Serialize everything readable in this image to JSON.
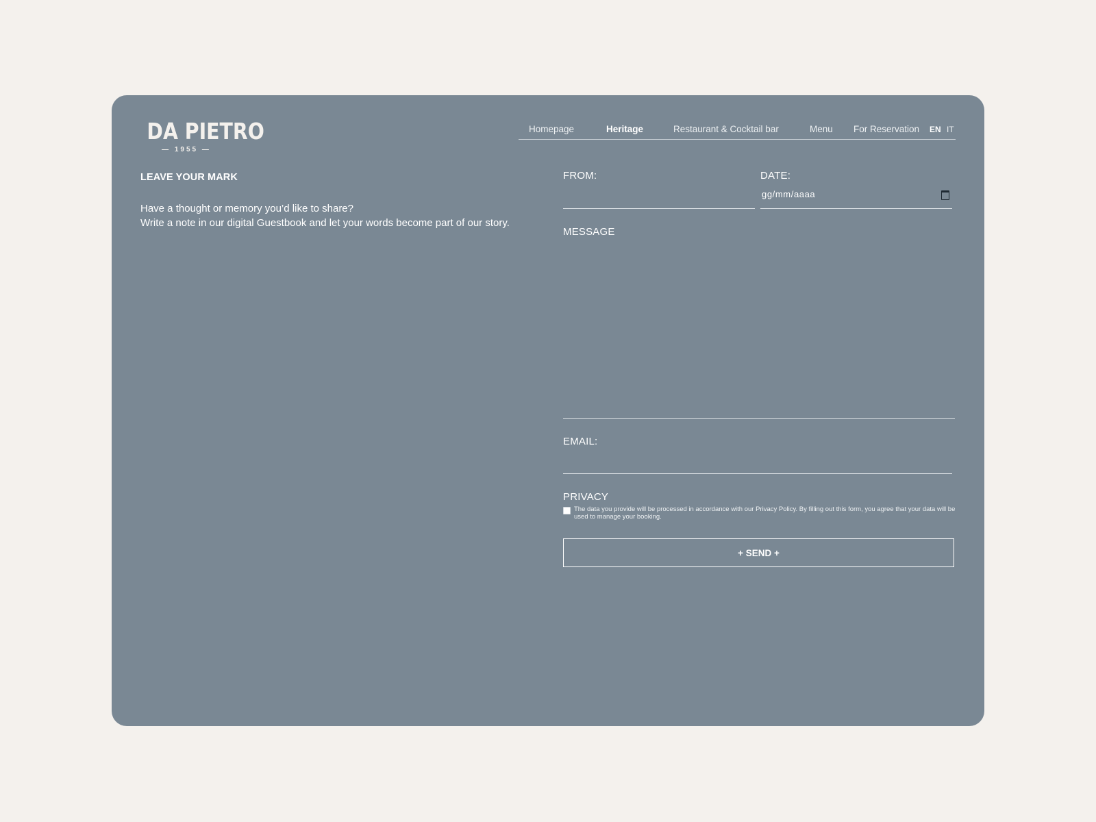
{
  "brand": {
    "name": "DA PIETRO",
    "year": "— 1955 —"
  },
  "nav": {
    "items": [
      "Homepage",
      "Heritage",
      "Restaurant & Cocktail bar",
      "Menu",
      "For Reservation"
    ],
    "active": "Heritage",
    "languages": [
      "EN",
      "IT"
    ],
    "active_language": "EN"
  },
  "intro": {
    "heading": "LEAVE YOUR MARK",
    "line1": "Have a thought or memory you’d like to share?",
    "line2": "Write a note in our digital Guestbook and let your words become part of our story."
  },
  "form": {
    "from_label": "FROM:",
    "from_value": "",
    "date_label": "DATE:",
    "date_placeholder": "gg/mm/aaaa",
    "message_label": "MESSAGE",
    "message_value": "",
    "email_label": "EMAIL:",
    "email_value": "",
    "privacy_label": "PRIVACY",
    "privacy_text": "The data you provide will be processed in accordance with our Privacy Policy. By filling out this form, you agree that your data will be used to manage your booking.",
    "privacy_checked": false,
    "send_label": "+ SEND +"
  },
  "colors": {
    "page_bg": "#f4f1ed",
    "card_bg": "#7a8894",
    "text": "#ffffff"
  }
}
